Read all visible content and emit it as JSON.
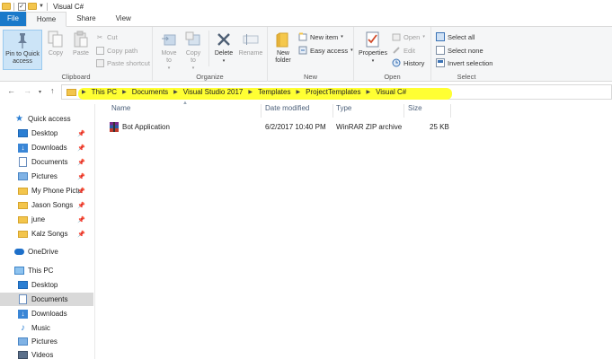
{
  "window": {
    "title": "Visual C#"
  },
  "tabs": [
    "File",
    "Home",
    "Share",
    "View"
  ],
  "ribbon": {
    "clipboard": {
      "label": "Clipboard",
      "pin": "Pin to Quick access",
      "copy": "Copy",
      "paste": "Paste",
      "cut": "Cut",
      "copy_path": "Copy path",
      "paste_shortcut": "Paste shortcut"
    },
    "organize": {
      "label": "Organize",
      "move_to": "Move to",
      "copy_to": "Copy to",
      "delete": "Delete",
      "rename": "Rename"
    },
    "new": {
      "label": "New",
      "new_folder": "New folder",
      "new_item": "New item",
      "easy_access": "Easy access"
    },
    "open": {
      "label": "Open",
      "properties": "Properties",
      "open": "Open",
      "edit": "Edit",
      "history": "History"
    },
    "select": {
      "label": "Select",
      "select_all": "Select all",
      "select_none": "Select none",
      "invert": "Invert selection"
    }
  },
  "address": {
    "breadcrumbs": [
      "This PC",
      "Documents",
      "Visual Studio 2017",
      "Templates",
      "ProjectTemplates",
      "Visual C#"
    ],
    "highlight_color": "#ffff33"
  },
  "nav_pane": {
    "quick_access": "Quick access",
    "pinned": [
      "Desktop",
      "Downloads",
      "Documents",
      "Pictures",
      "My Phone Pictu",
      "Jason Songs",
      "june",
      "Kalz Songs"
    ],
    "onedrive": "OneDrive",
    "this_pc": "This PC",
    "pc_items": [
      "Desktop",
      "Documents",
      "Downloads",
      "Music",
      "Pictures",
      "Videos"
    ],
    "selected": "Documents"
  },
  "columns": [
    "Name",
    "Date modified",
    "Type",
    "Size"
  ],
  "files": [
    {
      "name": "Bot Application",
      "date": "6/2/2017 10:40 PM",
      "type": "WinRAR ZIP archive",
      "size": "25 KB"
    }
  ]
}
